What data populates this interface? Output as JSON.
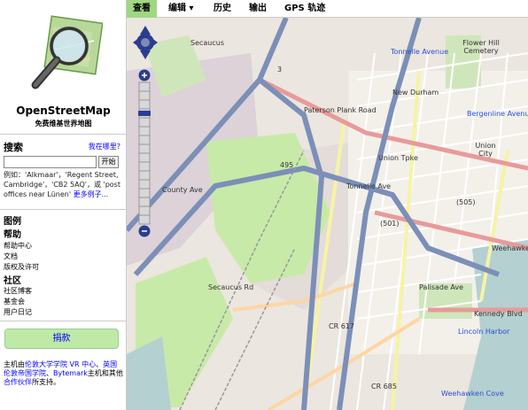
{
  "sidebar": {
    "title": "OpenStreetMap",
    "subtitle": "免费维基世界地图",
    "search": {
      "heading": "搜索",
      "where_link": "我在哪里?",
      "input_value": "",
      "button_label": "开始",
      "example_text": "例如：'Alkmaar'，'Regent Street, Cambridge'，'CB2 5AQ'，或 'post offices near Lünen'",
      "more_examples": "更多例子..."
    },
    "legend": "图例",
    "help": {
      "heading": "帮助",
      "items": [
        "帮助中心",
        "文档",
        "版权及许可"
      ]
    },
    "community": {
      "heading": "社区",
      "items": [
        "社区博客",
        "基金会",
        "用户日记"
      ]
    },
    "donate_label": "捐款",
    "hosting": {
      "prefix": "主机由",
      "ucl": "伦敦大学学院",
      "vr": "VR 中心",
      "sep1": "、",
      "bytemark": "英国伦敦帝国学院",
      "sep2": "、",
      "bytemark2": "Bytemark",
      "sep3": "主机和其他",
      "partners": "合作伙伴",
      "suffix": "所支持。"
    }
  },
  "tabs": [
    {
      "label": "查看",
      "active": true
    },
    {
      "label": "编辑 ▾",
      "active": false
    },
    {
      "label": "历史",
      "active": false
    },
    {
      "label": "输出",
      "active": false
    },
    {
      "label": "GPS 轨迹",
      "active": false
    }
  ],
  "map": {
    "labels": [
      {
        "text": "Secaucus",
        "color": "dark"
      },
      {
        "text": "Tonnelle Avenue",
        "color": "blue"
      },
      {
        "text": "Flower Hill Cemetery",
        "color": "dark"
      },
      {
        "text": "New Durham",
        "color": "dark"
      },
      {
        "text": "Bergenline Avenue",
        "color": "blue"
      },
      {
        "text": "Paterson Plank Road",
        "color": "dark"
      },
      {
        "text": "Union City",
        "color": "dark"
      },
      {
        "text": "Union Tpke",
        "color": "dark"
      },
      {
        "text": "495",
        "color": "dark"
      },
      {
        "text": "(505)",
        "color": "dark"
      },
      {
        "text": "(501)",
        "color": "dark"
      },
      {
        "text": "Weehawken",
        "color": "dark"
      },
      {
        "text": "County Ave",
        "color": "dark"
      },
      {
        "text": "Secaucus Rd",
        "color": "dark"
      },
      {
        "text": "CR 617",
        "color": "dark"
      },
      {
        "text": "CR 685",
        "color": "dark"
      },
      {
        "text": "Lincoln Harbor",
        "color": "blue"
      },
      {
        "text": "Weehawken Cove",
        "color": "blue"
      },
      {
        "text": "Palisade Ave",
        "color": "dark"
      },
      {
        "text": "Kennedy Blvd",
        "color": "dark"
      },
      {
        "text": "3",
        "color": "dark"
      },
      {
        "text": "Tonnelle Ave",
        "color": "dark"
      }
    ]
  }
}
